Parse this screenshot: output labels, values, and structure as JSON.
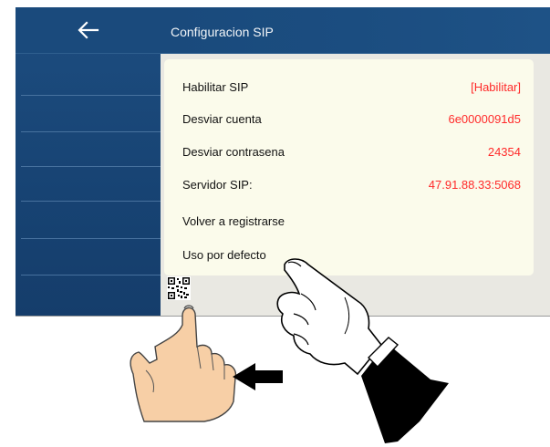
{
  "header": {
    "title": "Configuracion SIP"
  },
  "sidebar": {
    "back_icon": "arrow-left-icon"
  },
  "settings": [
    {
      "label": "Habilitar SIP",
      "value": "[Habilitar]"
    },
    {
      "label": "Desviar cuenta",
      "value": "6e0000091d5"
    },
    {
      "label": "Desviar contrasena",
      "value": "24354"
    },
    {
      "label": "Servidor SIP:",
      "value": "47.91.88.33:5068"
    },
    {
      "label": "Volver a registrarse",
      "value": ""
    },
    {
      "label": "Uso por defecto",
      "value": ""
    }
  ],
  "qr_icon": "qr-code-icon",
  "annotation": {
    "left_hand_icon": "pointing-hand-icon",
    "right_hand_icon": "pointing-hand-icon",
    "arrow_icon": "arrow-left-icon"
  },
  "colors": {
    "header": "#1b4d80",
    "sidebar": "#174373",
    "panel": "#fbfbeb",
    "value_text": "#ff2a2a"
  }
}
